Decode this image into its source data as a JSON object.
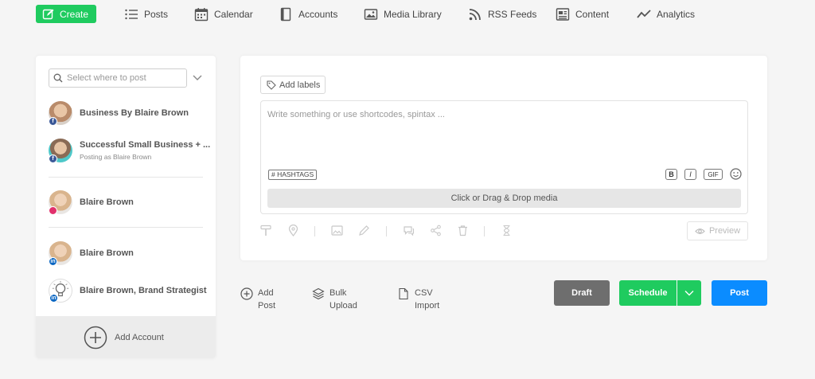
{
  "nav": {
    "create_label": "Create",
    "items": [
      {
        "label": "Posts",
        "icon": "list-icon"
      },
      {
        "label": "Calendar",
        "icon": "calendar-icon"
      },
      {
        "label": "Accounts",
        "icon": "accounts-icon"
      },
      {
        "label": "Media Library",
        "icon": "image-icon"
      },
      {
        "label": "RSS Feeds",
        "icon": "rss-icon"
      },
      {
        "label": "Content",
        "icon": "content-icon"
      },
      {
        "label": "Analytics",
        "icon": "analytics-icon"
      }
    ]
  },
  "accounts_panel": {
    "search_placeholder": "Select where to post",
    "accounts": [
      {
        "name": "Business By Blaire Brown",
        "network": "facebook",
        "badge": "f",
        "sub": ""
      },
      {
        "name": "Successful Small Business + ...",
        "network": "facebook",
        "badge": "f",
        "sub": "Posting as  Blaire Brown"
      },
      {
        "name": "Blaire Brown",
        "network": "instagram",
        "badge": "",
        "sub": ""
      },
      {
        "name": "Blaire Brown",
        "network": "linkedin",
        "badge": "in",
        "sub": ""
      },
      {
        "name": "Blaire Brown, Brand Strategist",
        "network": "linkedin",
        "badge": "in",
        "sub": ""
      }
    ],
    "add_account_label": "Add Account"
  },
  "composer": {
    "add_labels": "Add labels",
    "editor_placeholder": "Write something or use shortcodes, spintax ...",
    "hashtags": "# HASHTAGS",
    "bold": "B",
    "italic": "I",
    "gif": "GIF",
    "dropzone": "Click or Drag & Drop media",
    "preview": "Preview"
  },
  "actions": {
    "add_post": [
      "Add",
      "Post"
    ],
    "bulk_upload": [
      "Bulk",
      "Upload"
    ],
    "csv_import": [
      "CSV",
      "Import"
    ],
    "draft": "Draft",
    "schedule": "Schedule",
    "post": "Post"
  },
  "colors": {
    "accent_green": "#1fcb5f",
    "post_blue": "#0b8cff",
    "draft_gray": "#6e6e6e"
  }
}
